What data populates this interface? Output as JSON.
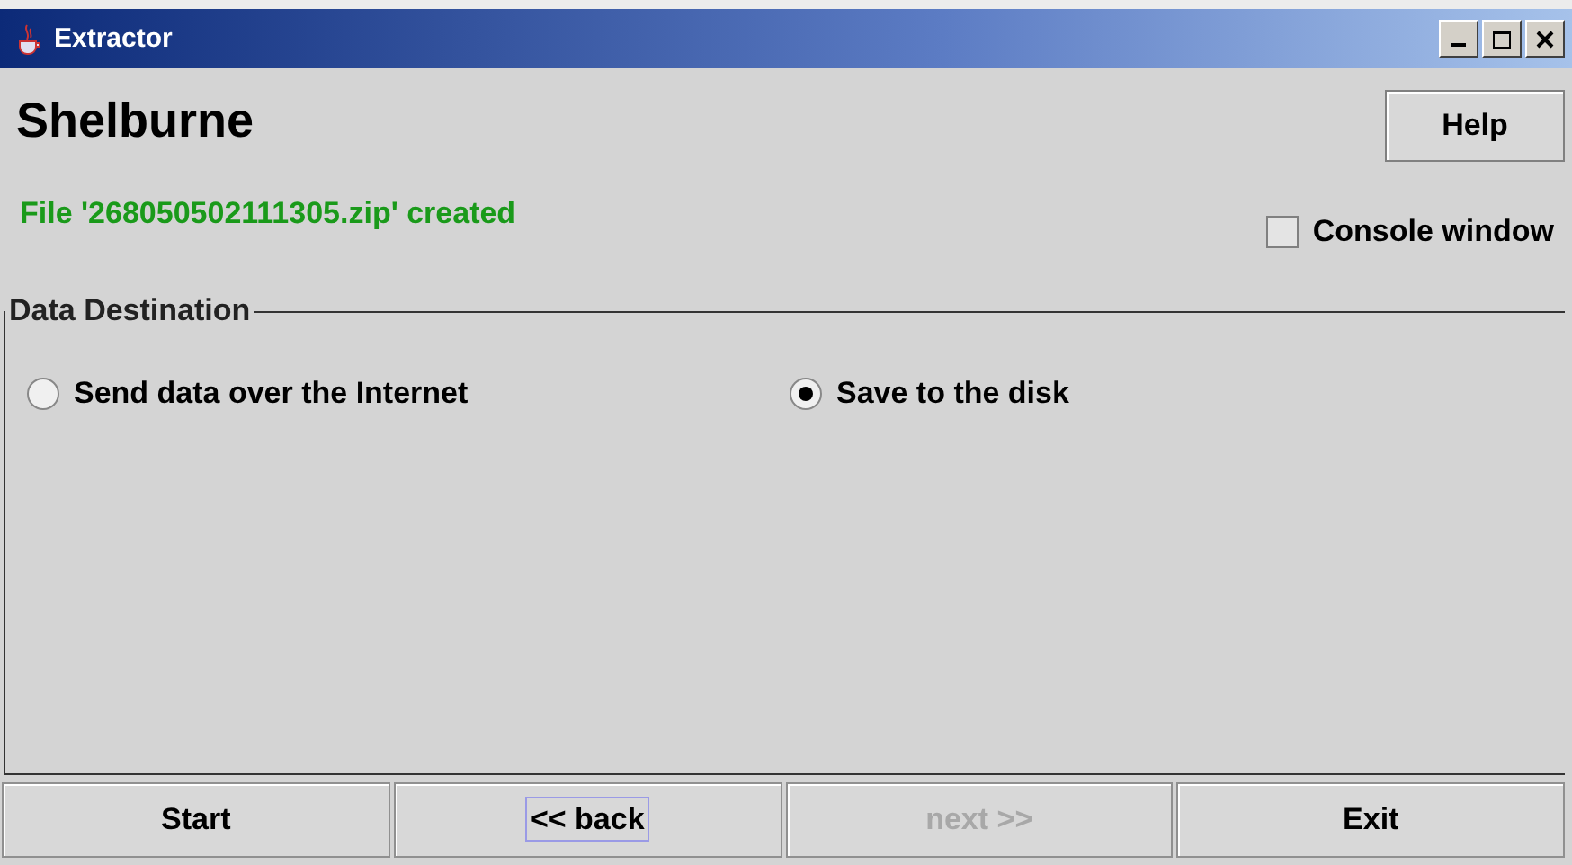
{
  "window": {
    "title": "Extractor"
  },
  "heading": "Shelburne",
  "help_button": "Help",
  "status_message": "File '268050502111305.zip' created",
  "console_window": {
    "label": "Console window",
    "checked": false
  },
  "data_destination": {
    "title": "Data Destination",
    "options": [
      {
        "label": "Send data over the Internet",
        "selected": false
      },
      {
        "label": "Save to the disk",
        "selected": true
      }
    ]
  },
  "buttons": [
    {
      "label": "Start",
      "disabled": false,
      "focused": false
    },
    {
      "label": "<< back",
      "disabled": false,
      "focused": true
    },
    {
      "label": "next >>",
      "disabled": true,
      "focused": false
    },
    {
      "label": "Exit",
      "disabled": false,
      "focused": false
    }
  ]
}
